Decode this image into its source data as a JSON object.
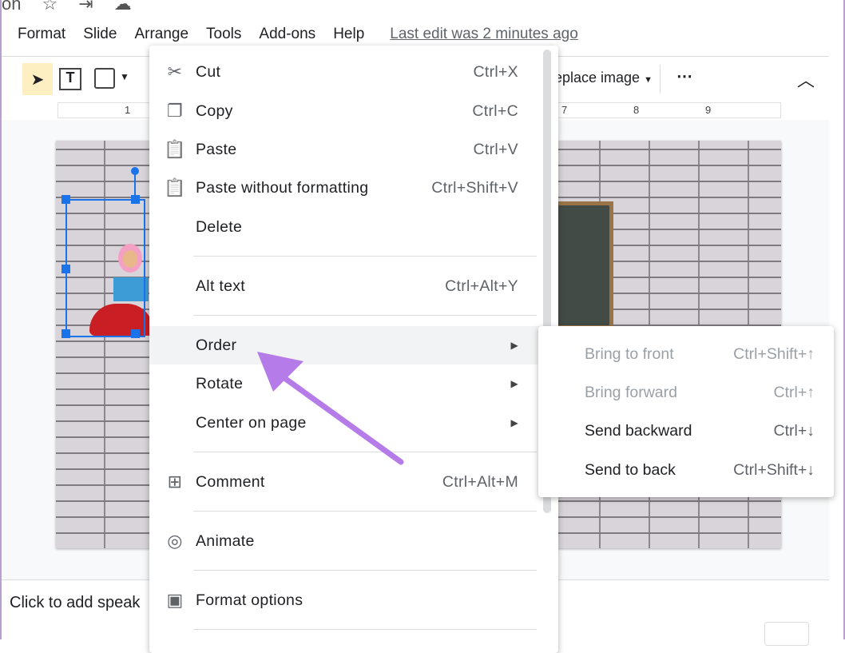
{
  "title_fragment": "on",
  "menubar": [
    "Format",
    "Slide",
    "Arrange",
    "Tools",
    "Add-ons",
    "Help"
  ],
  "last_edit": "Last edit was 2 minutes ago",
  "toolbar": {
    "replace_image": "eplace image",
    "more": "⋯"
  },
  "ruler": [
    "1",
    "7",
    "8",
    "9"
  ],
  "notes_placeholder": "Click to add speak",
  "context_menu": [
    {
      "icon": "scissors-icon",
      "glyph": "✂",
      "label": "Cut",
      "shortcut": "Ctrl+X"
    },
    {
      "icon": "copy-icon",
      "glyph": "❐",
      "label": "Copy",
      "shortcut": "Ctrl+C"
    },
    {
      "icon": "clipboard-icon",
      "glyph": "📋",
      "label": "Paste",
      "shortcut": "Ctrl+V"
    },
    {
      "icon": "paste-text-icon",
      "glyph": "📋",
      "label": "Paste without formatting",
      "shortcut": "Ctrl+Shift+V"
    },
    {
      "label": "Delete"
    },
    {
      "label": "Alt text",
      "shortcut": "Ctrl+Alt+Y"
    },
    {
      "label": "Order",
      "arrow": "▶"
    },
    {
      "label": "Rotate",
      "arrow": "▶"
    },
    {
      "label": "Center on page",
      "arrow": "▶"
    },
    {
      "icon": "add-comment-icon",
      "glyph": "⊞",
      "label": "Comment",
      "shortcut": "Ctrl+Alt+M"
    },
    {
      "icon": "animate-icon",
      "glyph": "◎",
      "label": "Animate"
    },
    {
      "icon": "format-paint-icon",
      "glyph": "▣",
      "label": "Format options"
    }
  ],
  "submenu": [
    {
      "label": "Bring to front",
      "shortcut": "Ctrl+Shift+↑",
      "disabled": true
    },
    {
      "label": "Bring forward",
      "shortcut": "Ctrl+↑",
      "disabled": true
    },
    {
      "label": "Send backward",
      "shortcut": "Ctrl+↓",
      "disabled": false
    },
    {
      "label": "Send to back",
      "shortcut": "Ctrl+Shift+↓",
      "disabled": false
    }
  ],
  "colors": {
    "selection": "#1a73e8",
    "arrow": "#b57be8",
    "highlight": "#f1f3f4"
  }
}
